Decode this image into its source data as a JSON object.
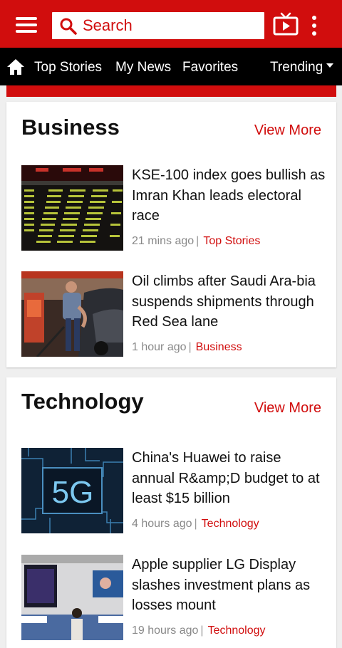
{
  "header": {
    "search_placeholder": "Search",
    "icons": [
      "hamburger-menu-icon",
      "search-icon",
      "tv-icon",
      "more-vertical-icon"
    ],
    "brand_color": "#d10d0d"
  },
  "nav": {
    "home_icon": "home-icon",
    "items": [
      "Top Stories",
      "My News",
      "Favorites"
    ],
    "trending_label": "Trending"
  },
  "sections": [
    {
      "title": "Business",
      "view_more": "View More",
      "articles": [
        {
          "headline": "KSE-100 index goes bullish as Imran Khan leads electoral race",
          "time": "21 mins ago",
          "category": "Top Stories"
        },
        {
          "headline": "Oil climbs after Saudi Ara-bia suspends shipments through Red Sea lane",
          "time": "1 hour ago",
          "category": "Business"
        }
      ]
    },
    {
      "title": "Technology",
      "view_more": "View More",
      "articles": [
        {
          "headline": "China's Huawei to raise annual R&amp;D budget to at least $15 billion",
          "time": "4 hours ago",
          "category": "Technology",
          "thumb_text": "5G"
        },
        {
          "headline": "Apple supplier LG Display slashes investment plans as losses mount",
          "time": "19 hours ago",
          "category": "Technology"
        }
      ]
    }
  ]
}
